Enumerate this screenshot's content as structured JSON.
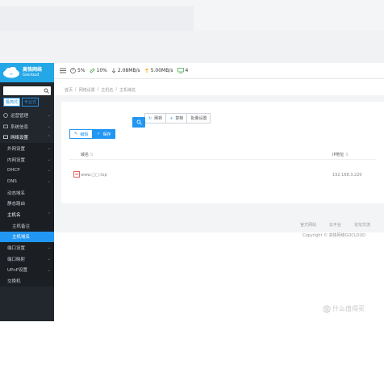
{
  "brand": {
    "name_cn": "高恪网络",
    "name_en": "Gocloud"
  },
  "sidebar": {
    "search_placeholder": "",
    "modes": {
      "simple": "极简式",
      "full": "专业式"
    },
    "items": [
      {
        "label": "运营管理",
        "icon": "shield-icon"
      },
      {
        "label": "系统信息",
        "icon": "monitor-icon"
      },
      {
        "label": "网络设置",
        "icon": "network-icon"
      },
      {
        "label": "外网设置"
      },
      {
        "label": "内网设置"
      },
      {
        "label": "DHCP"
      },
      {
        "label": "DNS"
      },
      {
        "label": "动态域名"
      },
      {
        "label": "静态路由"
      },
      {
        "label": "主机名"
      },
      {
        "label": "主机备注"
      },
      {
        "label": "主机域名"
      },
      {
        "label": "端口设置"
      },
      {
        "label": "端口映射"
      },
      {
        "label": "UPnP设置"
      },
      {
        "label": "交换机"
      }
    ]
  },
  "header": {
    "cpu": "5%",
    "mem": "10%",
    "download": "2.08MB/s",
    "upload": "5.00MB/s",
    "devices": "4"
  },
  "breadcrumb": [
    "首页",
    "网络设置",
    "主机名",
    "主机域名"
  ],
  "toolbar": {
    "refresh": "刷新",
    "copy": "复制",
    "batch": "批量设置"
  },
  "actions": {
    "edit": "编辑",
    "save": "保存"
  },
  "table": {
    "columns": [
      "域名",
      "IP地址"
    ],
    "rows": [
      {
        "domain": "www.□□.top",
        "ip": "192.168.3.220"
      }
    ]
  },
  "footer": {
    "links": [
      "官方网站",
      "云平台",
      "论坛交流"
    ],
    "copyright": "Copyright © 高恪网络GOCLOUD"
  },
  "watermark": "什么值得买",
  "colors": {
    "accent": "#2196f3",
    "sidebar": "#22272d",
    "logo": "#23a7e6"
  }
}
